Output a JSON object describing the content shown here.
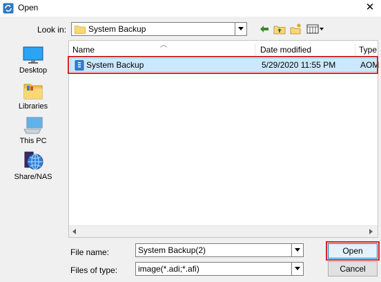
{
  "window": {
    "title": "Open",
    "app_icon": "refresh-icon",
    "close_icon": "close-icon"
  },
  "lookin": {
    "label": "Look in:",
    "value": "System Backup",
    "toolbar_icons": [
      "back-arrow-icon",
      "up-folder-icon",
      "new-folder-icon",
      "view-menu-icon"
    ]
  },
  "places": [
    {
      "label": "Desktop",
      "icon": "desktop-icon"
    },
    {
      "label": "Libraries",
      "icon": "libraries-icon"
    },
    {
      "label": "This PC",
      "icon": "computer-icon"
    },
    {
      "label": "Share/NAS",
      "icon": "network-globe-icon"
    }
  ],
  "filelist": {
    "columns": [
      "Name",
      "Date modified",
      "Type"
    ],
    "rows": [
      {
        "name": "System Backup",
        "date": "5/29/2020 11:55 PM",
        "type": "AOM",
        "selected": true
      }
    ]
  },
  "filename": {
    "label": "File name:",
    "value": "System Backup(2)"
  },
  "filetype": {
    "label": "Files of type:",
    "value": "image(*.adi;*.afi)"
  },
  "buttons": {
    "open": "Open",
    "cancel": "Cancel"
  },
  "colors": {
    "selection": "#cce8ff",
    "highlight_box": "#d1232a",
    "dialog_bg": "#f0f0f0"
  }
}
